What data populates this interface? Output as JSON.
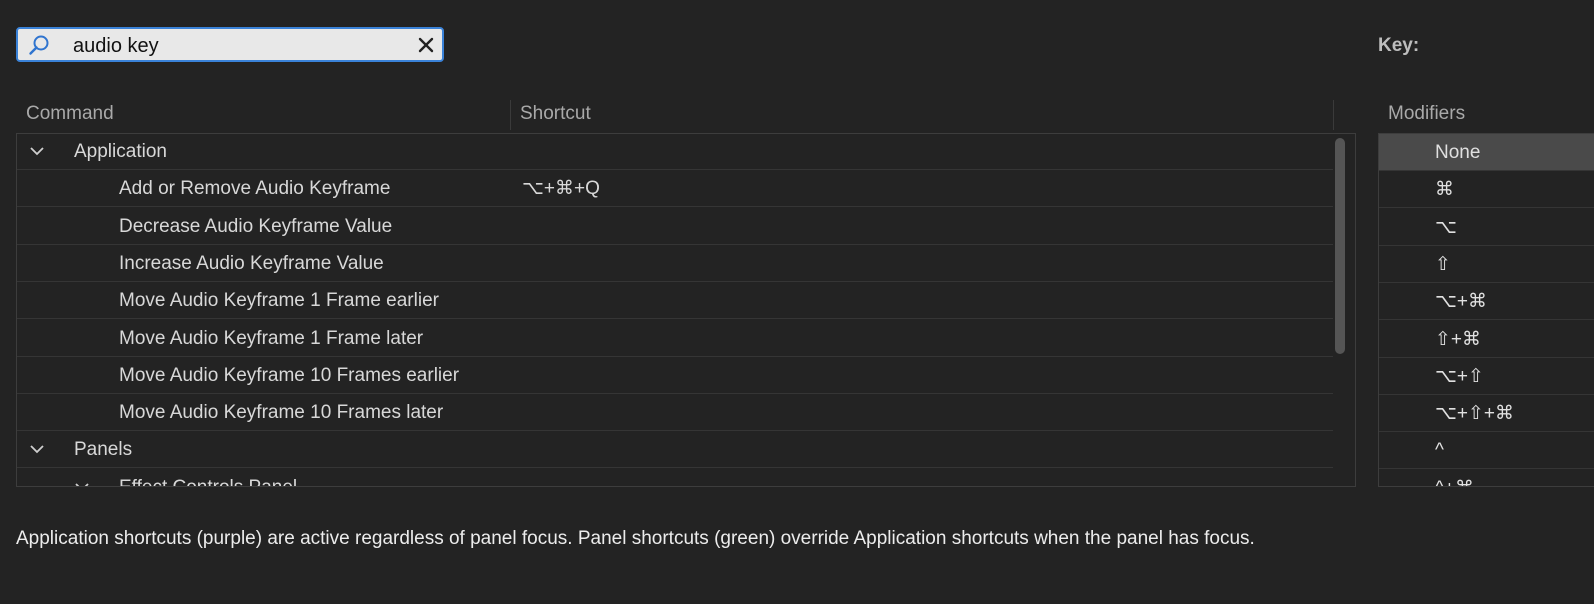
{
  "search": {
    "value": "audio key"
  },
  "key_label": "Key:",
  "columns": {
    "command": "Command",
    "shortcut": "Shortcut",
    "modifiers": "Modifiers"
  },
  "rows": [
    {
      "type": "group",
      "label": "Application",
      "shortcut": ""
    },
    {
      "type": "item",
      "label": "Add or Remove Audio Keyframe",
      "shortcut": "⌥+⌘+Q"
    },
    {
      "type": "item",
      "label": "Decrease Audio Keyframe Value",
      "shortcut": ""
    },
    {
      "type": "item",
      "label": "Increase Audio Keyframe Value",
      "shortcut": ""
    },
    {
      "type": "item",
      "label": "Move Audio Keyframe 1 Frame earlier",
      "shortcut": ""
    },
    {
      "type": "item",
      "label": "Move Audio Keyframe 1 Frame later",
      "shortcut": ""
    },
    {
      "type": "item",
      "label": "Move Audio Keyframe 10 Frames earlier",
      "shortcut": ""
    },
    {
      "type": "item",
      "label": "Move Audio Keyframe 10 Frames later",
      "shortcut": ""
    },
    {
      "type": "group",
      "label": "Panels",
      "shortcut": ""
    },
    {
      "type": "subgroup",
      "label": "Effect Controls Panel",
      "shortcut": ""
    }
  ],
  "modifiers": [
    "None",
    "⌘",
    "⌥",
    "⇧",
    "⌥+⌘",
    "⇧+⌘",
    "⌥+⇧",
    "⌥+⇧+⌘",
    "^",
    "^+⌘"
  ],
  "selected_modifier": "None",
  "footer": "Application shortcuts (purple) are active regardless of panel focus. Panel shortcuts (green) override Application shortcuts when the panel has focus.",
  "colors": {
    "accent": "#3a82d8",
    "background": "#232323",
    "selected": "#4a4a4a"
  }
}
